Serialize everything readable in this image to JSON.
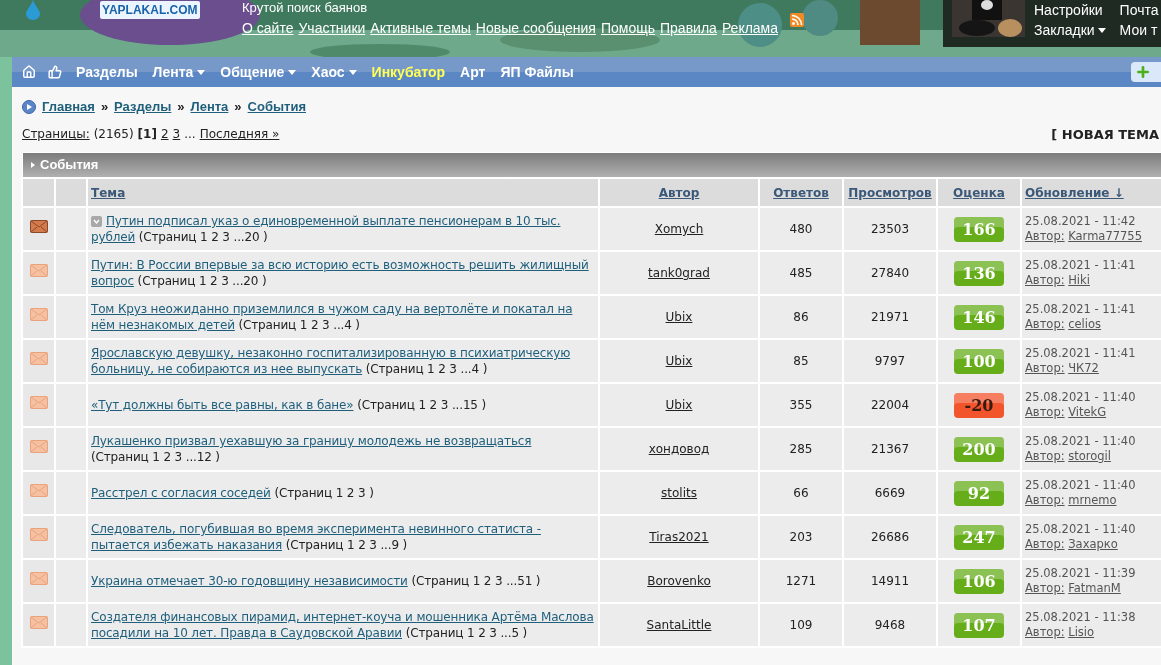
{
  "header": {
    "tagline": "Крутой поиск баянов",
    "logo_text": "YAPLAKAL.COM",
    "links": [
      "О сайте",
      "Участники",
      "Активные темы",
      "Новые сообщения",
      "Помощь",
      "Правила",
      "Реклама"
    ],
    "user_menu": [
      {
        "label": "Настройки",
        "dropdown": false
      },
      {
        "label": "Почта",
        "dropdown": false
      },
      {
        "label": "Закладки",
        "dropdown": true
      },
      {
        "label": "Мои т",
        "dropdown": false
      }
    ]
  },
  "nav": [
    {
      "label": "Разделы",
      "dropdown": false,
      "highlighted": false
    },
    {
      "label": "Лента",
      "dropdown": true,
      "highlighted": false
    },
    {
      "label": "Общение",
      "dropdown": true,
      "highlighted": false
    },
    {
      "label": "Хаос",
      "dropdown": true,
      "highlighted": false
    },
    {
      "label": "Инкубатор",
      "dropdown": false,
      "highlighted": true
    },
    {
      "label": "Арт",
      "dropdown": false,
      "highlighted": false
    },
    {
      "label": "ЯП Файлы",
      "dropdown": false,
      "highlighted": false
    }
  ],
  "breadcrumbs": [
    "Главная",
    "Разделы",
    "Лента",
    "События"
  ],
  "breadcrumb_separator": "»",
  "pagination": {
    "label": "Страницы:",
    "count": "(2165)",
    "pages": [
      {
        "label": "[1]",
        "selected": true
      },
      {
        "label": "2",
        "selected": false
      },
      {
        "label": "3",
        "selected": false
      }
    ],
    "ellipsis": "...",
    "last": "Последняя »"
  },
  "new_topic": "[ НОВАЯ ТЕМА",
  "forum": {
    "title": "События",
    "columns": [
      "Тема",
      "Автор",
      "Ответов",
      "Просмотров",
      "Оценка",
      "Обновление ↓"
    ],
    "rows": [
      {
        "unread": true,
        "marker": true,
        "title": "Путин подписал указ о единовременной выплате пенсионерам в 10 тыс. рублей",
        "pages": "(Страниц 1 2 3 ...20 )",
        "author": "Xomych",
        "replies": "480",
        "views": "23503",
        "rating": "166",
        "color": "#66ad1a",
        "updated": "25.08.2021 - 11:42",
        "last_label": "Автор:",
        "last_author": "Karma77755"
      },
      {
        "unread": false,
        "marker": false,
        "title": "Путин: В России впервые за всю историю есть возможность решить жилищный вопрос",
        "pages": "(Страниц 1 2 3 ...20 )",
        "author": "tank0grad",
        "replies": "485",
        "views": "27840",
        "rating": "136",
        "color": "#66ad1a",
        "updated": "25.08.2021 - 11:41",
        "last_label": "Автор:",
        "last_author": "Hiki"
      },
      {
        "unread": false,
        "marker": false,
        "title": "Том Круз неожиданно приземлился в чужом саду на вертолёте и покатал на нём незнакомых детей",
        "pages": "(Страниц 1 2 3 ...4 )",
        "author": "Ubix",
        "replies": "86",
        "views": "21971",
        "rating": "146",
        "color": "#66ad1a",
        "updated": "25.08.2021 - 11:41",
        "last_label": "Автор:",
        "last_author": "celios"
      },
      {
        "unread": false,
        "marker": false,
        "title": "Ярославскую девушку, незаконно госпитализированную в психиатрическую больницу, не собираются из нее выпускать",
        "pages": "(Страниц 1 2 3 ...4 )",
        "author": "Ubix",
        "replies": "85",
        "views": "9797",
        "rating": "100",
        "color": "#66ad1a",
        "updated": "25.08.2021 - 11:41",
        "last_label": "Автор:",
        "last_author": "ЧК72"
      },
      {
        "unread": false,
        "marker": false,
        "title": "«Тут должны быть все равны, как в бане»",
        "pages": "(Страниц 1 2 3 ...15 )",
        "author": "Ubix",
        "replies": "355",
        "views": "22004",
        "rating": "-20",
        "color": "#f2552b",
        "updated": "25.08.2021 - 11:40",
        "last_label": "Автор:",
        "last_author": "VitekG"
      },
      {
        "unread": false,
        "marker": false,
        "title": "Лукашенко призвал уехавшую за границу молодежь не возвращаться",
        "pages": "(Страниц 1 2 3 ...12 )",
        "author": "хондовод",
        "replies": "285",
        "views": "21367",
        "rating": "200",
        "color": "#66ad1a",
        "updated": "25.08.2021 - 11:40",
        "last_label": "Автор:",
        "last_author": "storogil"
      },
      {
        "unread": false,
        "marker": false,
        "title": "Расстрел с согласия соседей",
        "pages": "(Страниц 1 2 3 )",
        "author": "stolits",
        "replies": "66",
        "views": "6669",
        "rating": "92",
        "color": "#66ad1a",
        "updated": "25.08.2021 - 11:40",
        "last_label": "Автор:",
        "last_author": "mrnemo"
      },
      {
        "unread": false,
        "marker": false,
        "title": "Следователь, погубившая во время эксперимента невинного статиста - пытается избежать наказания",
        "pages": "(Страниц 1 2 3 ...9 )",
        "author": "Tiras2021",
        "replies": "203",
        "views": "26686",
        "rating": "247",
        "color": "#66ad1a",
        "updated": "25.08.2021 - 11:40",
        "last_label": "Автор:",
        "last_author": "Захарко"
      },
      {
        "unread": false,
        "marker": false,
        "title": "Украина отмечает 30-ю годовщину независимости",
        "pages": "(Страниц 1 2 3 ...51 )",
        "author": "Borovenko",
        "replies": "1271",
        "views": "14911",
        "rating": "106",
        "color": "#66ad1a",
        "updated": "25.08.2021 - 11:39",
        "last_label": "Автор:",
        "last_author": "FatmanM"
      },
      {
        "unread": false,
        "marker": false,
        "title": "Создателя финансовых пирамид, интернет-коуча и мошенника Артёма Маслова посадили на 10 лет. Правда в Саудовской Аравии",
        "pages": "(Страниц 1 2 3 ...5 )",
        "author": "SantaLittle",
        "replies": "109",
        "views": "9468",
        "rating": "107",
        "color": "#66ad1a",
        "updated": "25.08.2021 - 11:38",
        "last_label": "Автор:",
        "last_author": "Lisio"
      }
    ]
  }
}
